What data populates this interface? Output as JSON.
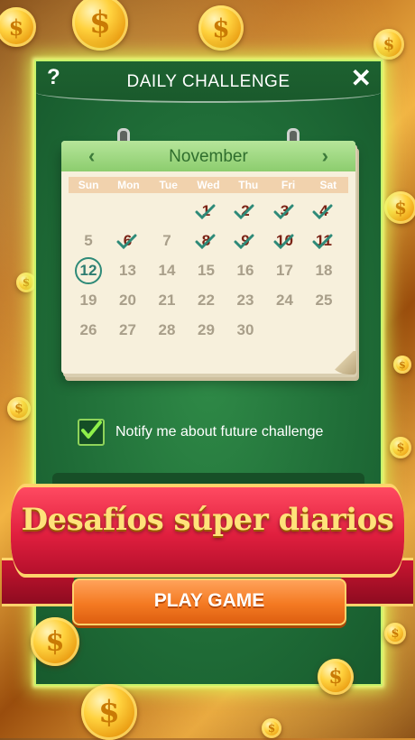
{
  "dialog": {
    "title": "DAILY CHALLENGE",
    "help_label": "?",
    "close_label": "✕"
  },
  "calendar": {
    "month": "November",
    "prev_label": "‹",
    "next_label": "›",
    "weekdays": [
      "Sun",
      "Mon",
      "Tue",
      "Wed",
      "Thu",
      "Fri",
      "Sat"
    ],
    "days": [
      {
        "day": "",
        "done": false
      },
      {
        "day": "",
        "done": false
      },
      {
        "day": "",
        "done": false
      },
      {
        "day": "1",
        "done": true
      },
      {
        "day": "2",
        "done": true
      },
      {
        "day": "3",
        "done": true
      },
      {
        "day": "4",
        "done": true
      },
      {
        "day": "5",
        "done": false
      },
      {
        "day": "6",
        "done": true
      },
      {
        "day": "7",
        "done": false
      },
      {
        "day": "8",
        "done": true
      },
      {
        "day": "9",
        "done": true
      },
      {
        "day": "10",
        "done": true
      },
      {
        "day": "11",
        "done": true
      },
      {
        "day": "12",
        "done": false,
        "today": true
      },
      {
        "day": "13",
        "done": false
      },
      {
        "day": "14",
        "done": false
      },
      {
        "day": "15",
        "done": false
      },
      {
        "day": "16",
        "done": false
      },
      {
        "day": "17",
        "done": false
      },
      {
        "day": "18",
        "done": false
      },
      {
        "day": "19",
        "done": false
      },
      {
        "day": "20",
        "done": false
      },
      {
        "day": "21",
        "done": false
      },
      {
        "day": "22",
        "done": false
      },
      {
        "day": "23",
        "done": false
      },
      {
        "day": "24",
        "done": false
      },
      {
        "day": "25",
        "done": false
      },
      {
        "day": "26",
        "done": false
      },
      {
        "day": "27",
        "done": false
      },
      {
        "day": "28",
        "done": false
      },
      {
        "day": "29",
        "done": false
      },
      {
        "day": "30",
        "done": false
      }
    ]
  },
  "notify": {
    "label": "Notify me about future challenge",
    "checked": true
  },
  "banner": {
    "text": "Desafíos súper diarios"
  },
  "play_button": {
    "label": "PLAY GAME"
  },
  "coin_glyph": "$",
  "colors": {
    "panel_green": "#1f6c37",
    "ribbon_red": "#e01f3e",
    "button_orange": "#f47a22",
    "banner_text": "#ffe27a",
    "check_green": "#2e8a78"
  }
}
